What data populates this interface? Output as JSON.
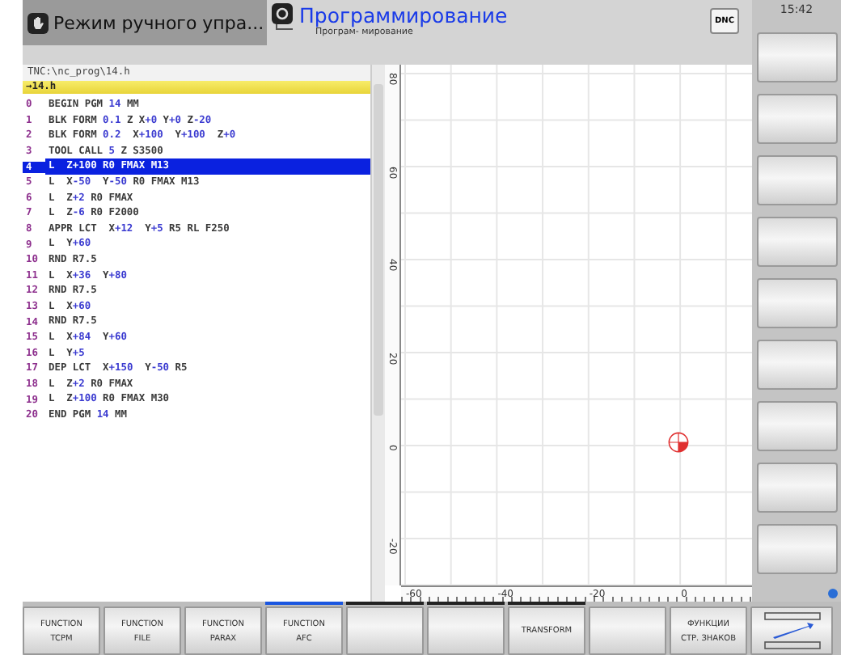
{
  "header": {
    "mode_tab": {
      "label": "Режим ручного упра...",
      "selected": false
    },
    "program_tab": {
      "label": "Программирование",
      "sublabel": "Програм- мирование",
      "selected": true
    },
    "dnc": "DNC",
    "time": "15:42"
  },
  "program": {
    "path": "TNC:\\nc_prog\\14.h",
    "file": "→14.h",
    "lines": [
      {
        "number": "0",
        "selected": false,
        "parts": [
          {
            "text": "BEGIN PGM ",
            "kind": "word"
          },
          {
            "text": "14",
            "kind": "value"
          },
          {
            "text": " MM",
            "kind": "word"
          }
        ]
      },
      {
        "number": "1",
        "selected": false,
        "parts": [
          {
            "text": "BLK FORM ",
            "kind": "word"
          },
          {
            "text": "0.1",
            "kind": "value"
          },
          {
            "text": " Z X",
            "kind": "word"
          },
          {
            "text": "+0",
            "kind": "value"
          },
          {
            "text": " Y",
            "kind": "word"
          },
          {
            "text": "+0",
            "kind": "value"
          },
          {
            "text": " Z",
            "kind": "word"
          },
          {
            "text": "-20",
            "kind": "value"
          }
        ]
      },
      {
        "number": "2",
        "selected": false,
        "parts": [
          {
            "text": "BLK FORM ",
            "kind": "word"
          },
          {
            "text": "0.2",
            "kind": "value"
          },
          {
            "text": "  X",
            "kind": "word"
          },
          {
            "text": "+100",
            "kind": "value"
          },
          {
            "text": "  Y",
            "kind": "word"
          },
          {
            "text": "+100",
            "kind": "value"
          },
          {
            "text": "  Z",
            "kind": "word"
          },
          {
            "text": "+0",
            "kind": "value"
          }
        ]
      },
      {
        "number": "3",
        "selected": false,
        "parts": [
          {
            "text": "TOOL CALL ",
            "kind": "word"
          },
          {
            "text": "5",
            "kind": "value"
          },
          {
            "text": " Z S3500",
            "kind": "word"
          }
        ]
      },
      {
        "number": "4",
        "selected": true,
        "parts": [
          {
            "text": "L  Z+100 R0 FMAX M13",
            "kind": "word"
          }
        ]
      },
      {
        "number": "5",
        "selected": false,
        "parts": [
          {
            "text": "L  X",
            "kind": "word"
          },
          {
            "text": "-50",
            "kind": "value"
          },
          {
            "text": "  Y",
            "kind": "word"
          },
          {
            "text": "-50",
            "kind": "value"
          },
          {
            "text": " R0 FMAX M13",
            "kind": "word"
          }
        ]
      },
      {
        "number": "6",
        "selected": false,
        "parts": [
          {
            "text": "L  Z",
            "kind": "word"
          },
          {
            "text": "+2",
            "kind": "value"
          },
          {
            "text": " R0 FMAX",
            "kind": "word"
          }
        ]
      },
      {
        "number": "7",
        "selected": false,
        "parts": [
          {
            "text": "L  Z",
            "kind": "word"
          },
          {
            "text": "-6",
            "kind": "value"
          },
          {
            "text": " R0 F2000",
            "kind": "word"
          }
        ]
      },
      {
        "number": "8",
        "selected": false,
        "parts": [
          {
            "text": "APPR LCT  X",
            "kind": "word"
          },
          {
            "text": "+12",
            "kind": "value"
          },
          {
            "text": "  Y",
            "kind": "word"
          },
          {
            "text": "+5",
            "kind": "value"
          },
          {
            "text": " R5 RL F250",
            "kind": "word"
          }
        ]
      },
      {
        "number": "9",
        "selected": false,
        "parts": [
          {
            "text": "L  Y",
            "kind": "word"
          },
          {
            "text": "+60",
            "kind": "value"
          }
        ]
      },
      {
        "number": "10",
        "selected": false,
        "parts": [
          {
            "text": "RND R7.5",
            "kind": "word"
          }
        ]
      },
      {
        "number": "11",
        "selected": false,
        "parts": [
          {
            "text": "L  X",
            "kind": "word"
          },
          {
            "text": "+36",
            "kind": "value"
          },
          {
            "text": "  Y",
            "kind": "word"
          },
          {
            "text": "+80",
            "kind": "value"
          }
        ]
      },
      {
        "number": "12",
        "selected": false,
        "parts": [
          {
            "text": "RND R7.5",
            "kind": "word"
          }
        ]
      },
      {
        "number": "13",
        "selected": false,
        "parts": [
          {
            "text": "L  X",
            "kind": "word"
          },
          {
            "text": "+60",
            "kind": "value"
          }
        ]
      },
      {
        "number": "14",
        "selected": false,
        "parts": [
          {
            "text": "RND R7.5",
            "kind": "word"
          }
        ]
      },
      {
        "number": "15",
        "selected": false,
        "parts": [
          {
            "text": "L  X",
            "kind": "word"
          },
          {
            "text": "+84",
            "kind": "value"
          },
          {
            "text": "  Y",
            "kind": "word"
          },
          {
            "text": "+60",
            "kind": "value"
          }
        ]
      },
      {
        "number": "16",
        "selected": false,
        "parts": [
          {
            "text": "L  Y",
            "kind": "word"
          },
          {
            "text": "+5",
            "kind": "value"
          }
        ]
      },
      {
        "number": "17",
        "selected": false,
        "parts": [
          {
            "text": "DEP LCT  X",
            "kind": "word"
          },
          {
            "text": "+150",
            "kind": "value"
          },
          {
            "text": "  Y",
            "kind": "word"
          },
          {
            "text": "-50",
            "kind": "value"
          },
          {
            "text": " R5",
            "kind": "word"
          }
        ]
      },
      {
        "number": "18",
        "selected": false,
        "parts": [
          {
            "text": "L  Z",
            "kind": "word"
          },
          {
            "text": "+2",
            "kind": "value"
          },
          {
            "text": " R0 FMAX",
            "kind": "word"
          }
        ]
      },
      {
        "number": "19",
        "selected": false,
        "parts": [
          {
            "text": "L  Z",
            "kind": "word"
          },
          {
            "text": "+100",
            "kind": "value"
          },
          {
            "text": " R0 FMAX M30",
            "kind": "word"
          }
        ]
      },
      {
        "number": "20",
        "selected": false,
        "parts": [
          {
            "text": "END PGM ",
            "kind": "word"
          },
          {
            "text": "14",
            "kind": "value"
          },
          {
            "text": " MM",
            "kind": "word"
          }
        ]
      }
    ]
  },
  "graphics": {
    "y_labels": [
      "80",
      "60",
      "40",
      "20",
      "0",
      "-20"
    ],
    "x_labels": [
      "-60",
      "-40",
      "-20",
      "0"
    ]
  },
  "softkey_pages": [
    {
      "selected": true
    },
    {
      "selected": false
    },
    {
      "selected": false
    },
    {
      "selected": false
    }
  ],
  "softkeys": [
    {
      "kind": "label",
      "lines": [
        "FUNCTION",
        "TCPM"
      ]
    },
    {
      "kind": "label",
      "lines": [
        "FUNCTION",
        "FILE"
      ]
    },
    {
      "kind": "label",
      "lines": [
        "FUNCTION",
        "PARAX"
      ]
    },
    {
      "kind": "label",
      "lines": [
        "FUNCTION",
        "AFC"
      ]
    },
    {
      "kind": "blank"
    },
    {
      "kind": "blank"
    },
    {
      "kind": "label",
      "lines": [
        "TRANSFORM"
      ]
    },
    {
      "kind": "blank"
    },
    {
      "kind": "label",
      "lines": [
        "ФУНКЦИИ",
        "СТР. ЗНАКОВ"
      ]
    }
  ]
}
